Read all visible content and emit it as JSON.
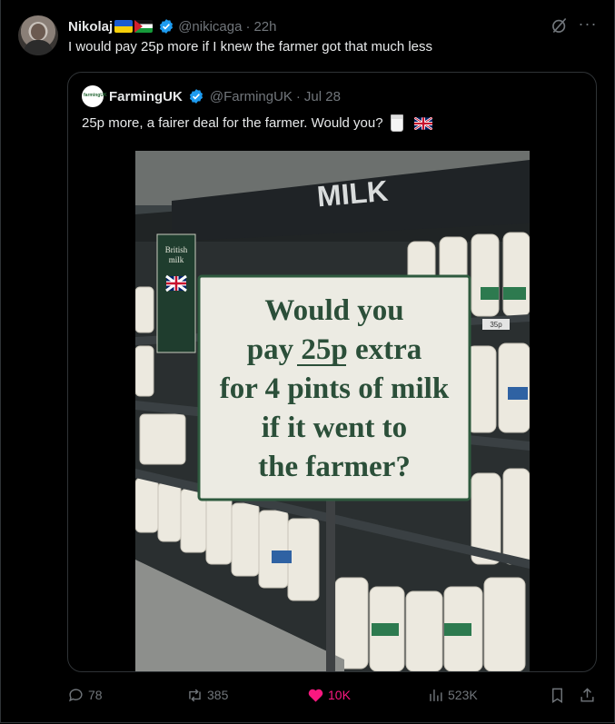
{
  "tweet": {
    "author_name": "Nikolaj",
    "handle": "@nikicaga",
    "separator": "·",
    "time": "22h",
    "text": "I would pay 25p more if I knew the farmer got that much less"
  },
  "quoted": {
    "author_name": "FarmingUK",
    "logo_text": "farmingUK",
    "handle": "@FarmingUK",
    "separator": "·",
    "date": "Jul 28",
    "text": "25p more, a fairer deal for the farmer. Would you?",
    "image": {
      "header_sign": "MILK",
      "side_sign": [
        "British",
        "milk"
      ],
      "sign_lines": [
        "Would you",
        "pay 25p extra",
        "for 4 pints of milk",
        "if it went to",
        "the farmer?"
      ],
      "price_tag": "35p"
    }
  },
  "actions": {
    "replies": "78",
    "reposts": "385",
    "likes": "10K",
    "views": "523K"
  },
  "colors": {
    "background": "#000000",
    "border": "#2f3336",
    "muted": "#71767b",
    "verified": "#1d9bf0",
    "like": "#f91880"
  }
}
